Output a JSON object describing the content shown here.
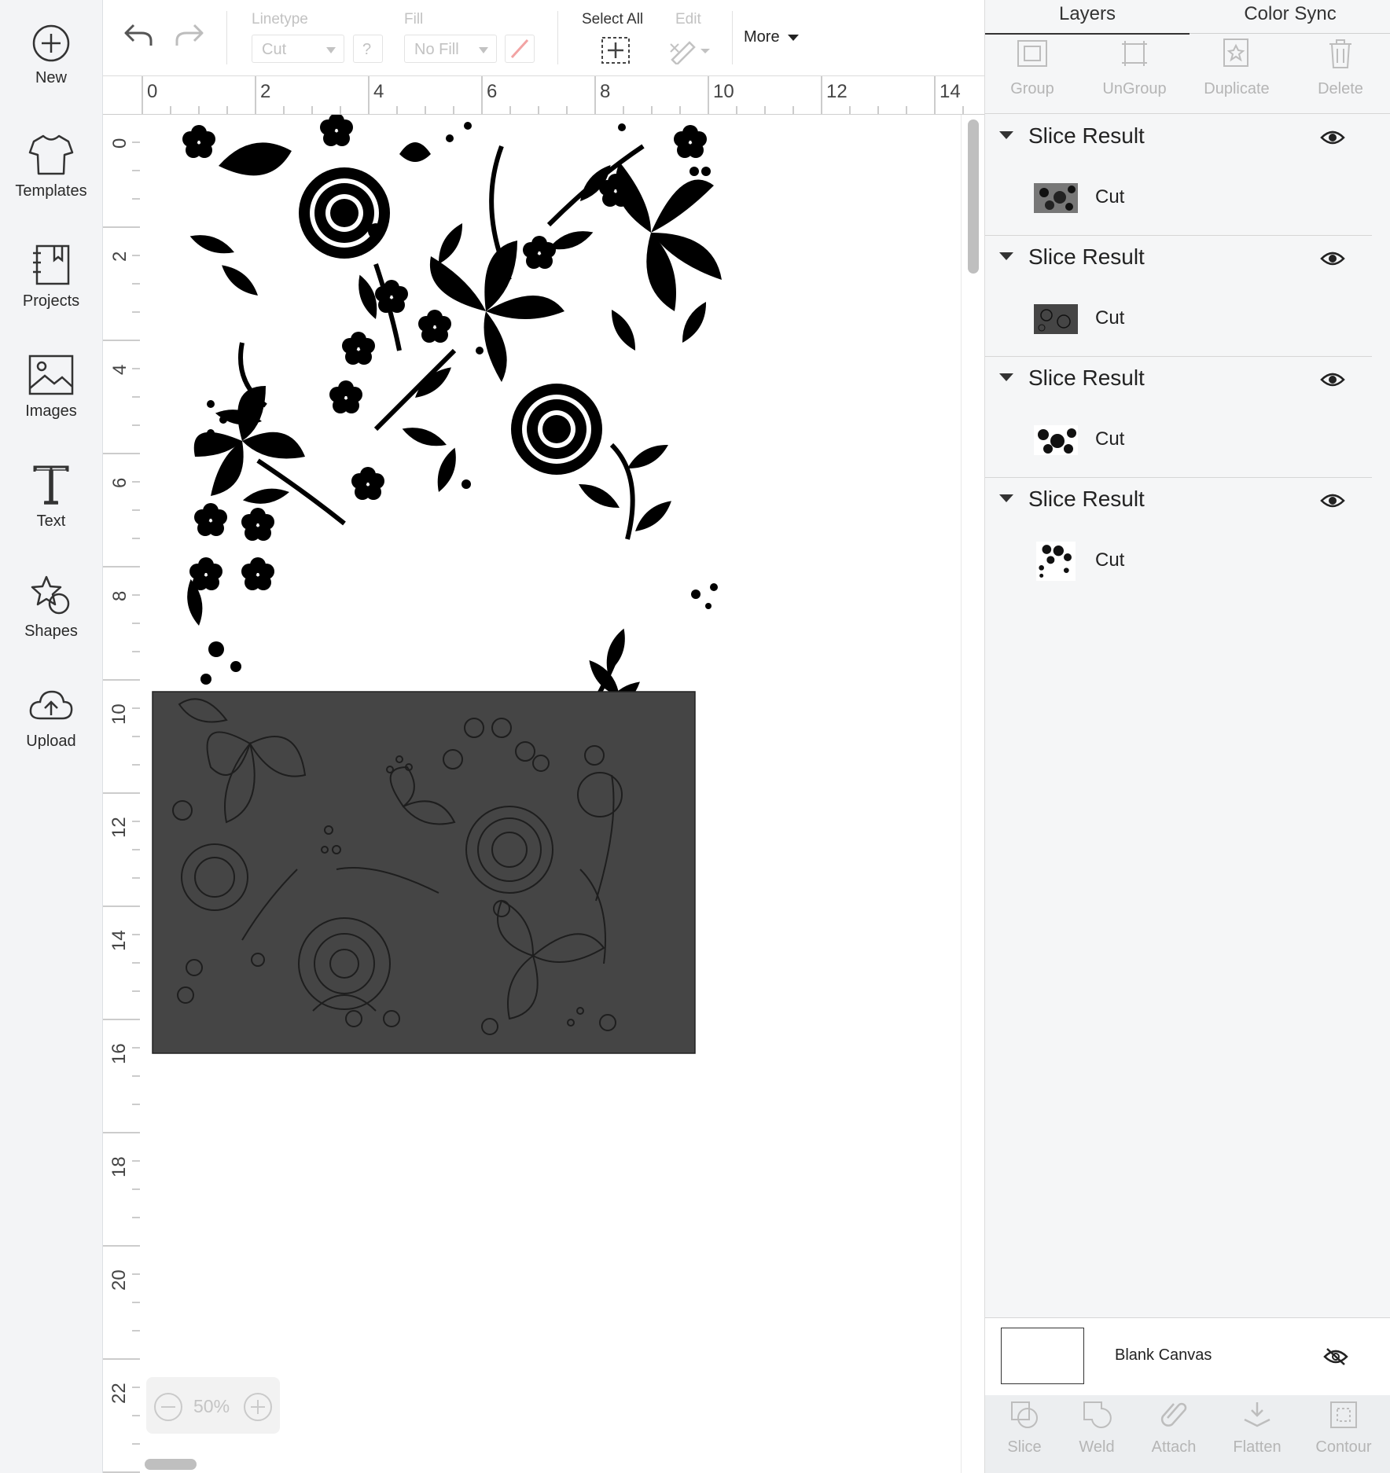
{
  "sidebar": {
    "items": [
      {
        "label": "New",
        "icon": "plus-circle-icon"
      },
      {
        "label": "Templates",
        "icon": "tshirt-icon"
      },
      {
        "label": "Projects",
        "icon": "notebook-icon"
      },
      {
        "label": "Images",
        "icon": "image-icon"
      },
      {
        "label": "Text",
        "icon": "text-t-icon"
      },
      {
        "label": "Shapes",
        "icon": "shapes-star-icon"
      },
      {
        "label": "Upload",
        "icon": "cloud-upload-icon"
      }
    ]
  },
  "toolbar": {
    "linetype_label": "Linetype",
    "linetype_value": "Cut",
    "help": "?",
    "fill_label": "Fill",
    "fill_value": "No Fill",
    "select_all_label": "Select All",
    "edit_label": "Edit",
    "more_label": "More"
  },
  "rulers": {
    "horizontal": [
      "0",
      "2",
      "4",
      "6",
      "8",
      "10",
      "12",
      "14"
    ],
    "vertical": [
      "0",
      "2",
      "4",
      "6",
      "8",
      "10",
      "12",
      "14",
      "16",
      "18",
      "20",
      "22"
    ]
  },
  "zoom": {
    "value": "50%"
  },
  "panel": {
    "tabs": [
      "Layers",
      "Color Sync"
    ],
    "actions": [
      "Group",
      "UnGroup",
      "Duplicate",
      "Delete"
    ],
    "layer_groups": [
      {
        "title": "Slice Result",
        "item": "Cut"
      },
      {
        "title": "Slice Result",
        "item": "Cut"
      },
      {
        "title": "Slice Result",
        "item": "Cut"
      },
      {
        "title": "Slice Result",
        "item": "Cut"
      }
    ],
    "blank_canvas_label": "Blank Canvas",
    "bottom_actions": [
      "Slice",
      "Weld",
      "Attach",
      "Flatten",
      "Contour"
    ]
  },
  "colors": {
    "canvas_dark_layer": "#454545",
    "floral_black": "#000000",
    "sidebar_bg": "#f3f4f6",
    "panel_bg": "#f5f6f7",
    "disabled_text": "#b5b5b5"
  }
}
